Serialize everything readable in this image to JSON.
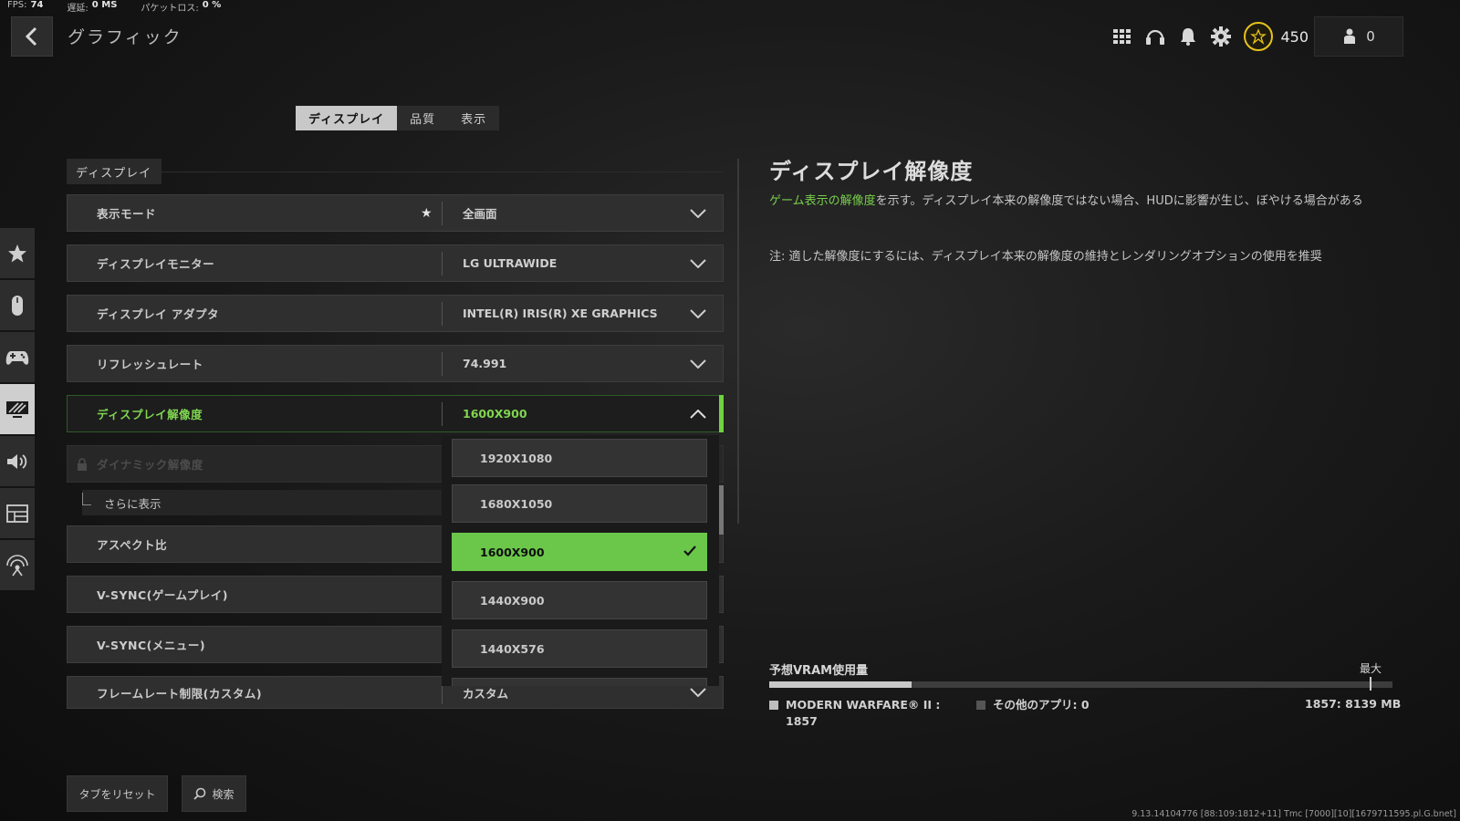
{
  "stats": {
    "fps_label": "FPS:",
    "fps_value": "74",
    "latency_label": "遅延:",
    "latency_value": "0 MS",
    "packetloss_label": "パケットロス:",
    "packetloss_value": "0 %"
  },
  "header": {
    "title": "グラフィック",
    "cp_value": "450",
    "player_count": "0"
  },
  "tabs": [
    {
      "label": "ディスプレイ",
      "active": true
    },
    {
      "label": "品質",
      "active": false
    },
    {
      "label": "表示",
      "active": false
    }
  ],
  "section": {
    "label": "ディスプレイ"
  },
  "rows": [
    {
      "label": "表示モード",
      "value": "全画面"
    },
    {
      "label": "ディスプレイモニター",
      "value": "LG ULTRAWIDE"
    },
    {
      "label": "ディスプレイ アダプタ",
      "value": "INTEL(R) IRIS(R) XE GRAPHICS"
    },
    {
      "label": "リフレッシュレート",
      "value": "74.991"
    },
    {
      "label": "ディスプレイ解像度",
      "value": "1600X900"
    },
    {
      "label": "ダイナミック解像度",
      "value": ""
    },
    {
      "label": "アスペクト比",
      "value": ""
    },
    {
      "label": "V-SYNC(ゲームプレイ)",
      "value": ""
    },
    {
      "label": "V-SYNC(メニュー)",
      "value": ""
    },
    {
      "label": "フレームレート制限(カスタム)",
      "value": "カスタム"
    }
  ],
  "show_more": "さらに表示",
  "resolution_options": [
    "1920X1080",
    "1680X1050",
    "1600X900",
    "1440X900",
    "1440X576"
  ],
  "selected_resolution": "1600X900",
  "detail": {
    "title": "ディスプレイ解像度",
    "desc_highlight": "ゲーム表示の解像度",
    "desc_rest": "を示す。ディスプレイ本来の解像度ではない場合、HUDに影響が生じ、ぼやける場合がある",
    "note": "注: 適した解像度にするには、ディスプレイ本来の解像度の維持とレンダリングオプションの使用を推奨"
  },
  "vram": {
    "label": "予想VRAM使用量",
    "max_label": "最大",
    "game_label": "MODERN WARFARE® II :",
    "game_value": "1857",
    "other_label": "その他のアプリ: 0",
    "total": "1857: 8139 MB",
    "used": 1857,
    "capacity": 8139
  },
  "bottom": {
    "reset_label": "タブをリセット",
    "search_label": "検索"
  },
  "build_info": "9.13.14104776 [88:109:1812+11] Tmc [7000][10][1679711595.pl.G.bnet]",
  "colors": {
    "accent": "#6fd241",
    "selected_option": "#6bc74a",
    "coin": "#e7c21d"
  }
}
